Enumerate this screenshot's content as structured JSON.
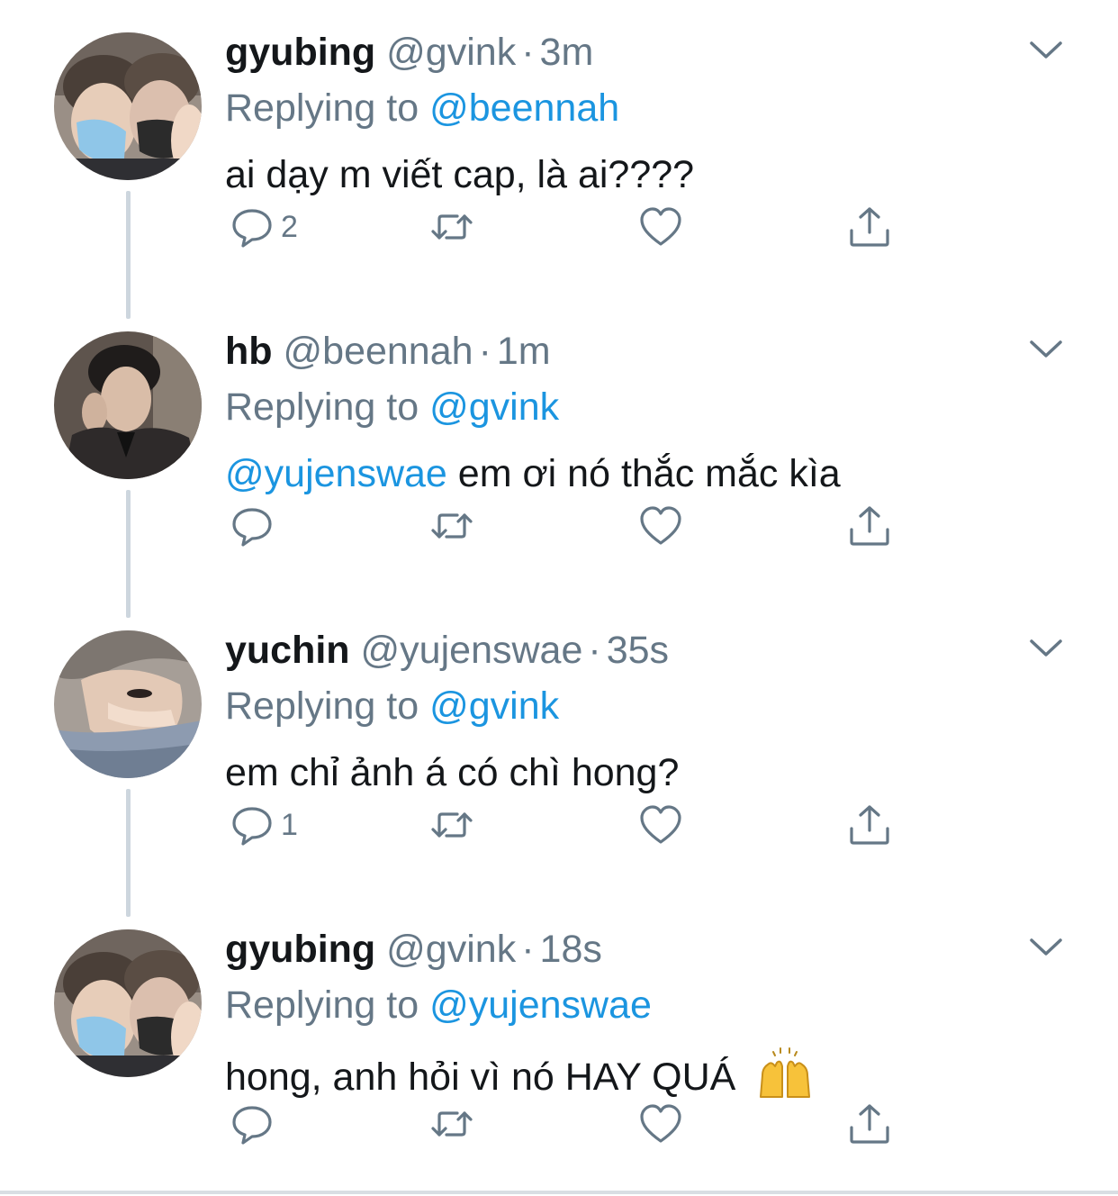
{
  "colors": {
    "accent": "#1b95e0",
    "secondary_text": "#657786",
    "primary_text": "#14171a",
    "thread_line": "#cdd6de"
  },
  "replying_prefix": "Replying to",
  "tweets": [
    {
      "name": "gyubing",
      "handle": "@gvink",
      "time": "3m",
      "replying_to": "@beennah",
      "text_mention": "",
      "text": "ai dạy m viết cap, là ai????",
      "reply_count": "2",
      "avatar": "couple-masked-avatar"
    },
    {
      "name": "hb",
      "handle": "@beennah",
      "time": "1m",
      "replying_to": "@gvink",
      "text_mention": "@yujenswae",
      "text": " em ơi nó thắc mắc kìa",
      "reply_count": "",
      "avatar": "dark-portrait-avatar"
    },
    {
      "name": "yuchin",
      "handle": "@yujenswae",
      "time": "35s",
      "replying_to": "@gvink",
      "text_mention": "",
      "text": "em chỉ ảnh á có chì hong?",
      "reply_count": "1",
      "avatar": "lying-down-avatar"
    },
    {
      "name": "gyubing",
      "handle": "@gvink",
      "time": "18s",
      "replying_to": "@yujenswae",
      "text_mention": "",
      "text": "hong, anh hỏi vì nó HAY QUÁ",
      "reply_count": "",
      "avatar": "couple-masked-avatar",
      "emoji": "raising-hands-emoji"
    }
  ],
  "icons": {
    "reply": "reply-icon",
    "retweet": "retweet-icon",
    "like": "heart-icon",
    "share": "share-icon",
    "more": "chevron-down-icon"
  }
}
